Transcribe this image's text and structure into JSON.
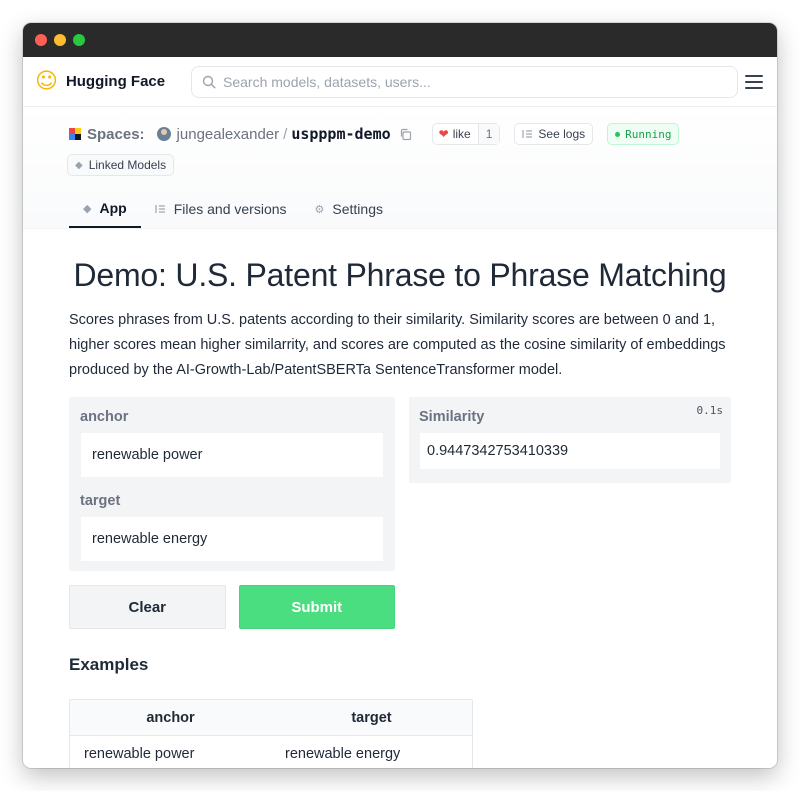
{
  "window": {
    "controls": [
      "close",
      "minimize",
      "zoom"
    ]
  },
  "navbar": {
    "brand": "Hugging Face",
    "logo_icon": "hugging-face-emoji",
    "search_placeholder": "Search models, datasets, users...",
    "menu_icon": "hamburger-menu-icon"
  },
  "space": {
    "section_label": "Spaces:",
    "owner": "jungealexander",
    "separator": "/",
    "repo": "uspppm-demo",
    "like_label": "like",
    "like_count": "1",
    "logs_label": "See logs",
    "status": "Running",
    "linked_models_label": "Linked Models",
    "tabs": [
      {
        "label": "App",
        "active": true
      },
      {
        "label": "Files and versions",
        "active": false
      },
      {
        "label": "Settings",
        "active": false
      }
    ]
  },
  "demo": {
    "title": "Demo: U.S. Patent Phrase to Phrase Matching",
    "description": "Scores phrases from U.S. patents according to their similarity. Similarity scores are between 0 and 1, higher scores mean higher similarrity, and scores are computed as the cosine similarity of embeddings produced by the AI-Growth-Lab/PatentSBERTa SentenceTransformer model."
  },
  "inputs": {
    "anchor_label": "anchor",
    "anchor_value": "renewable power",
    "target_label": "target",
    "target_value": "renewable energy"
  },
  "buttons": {
    "clear": "Clear",
    "submit": "Submit"
  },
  "output": {
    "label": "Similarity",
    "time": "0.1s",
    "value": "0.9447342753410339"
  },
  "examples": {
    "title": "Examples",
    "columns": [
      "anchor",
      "target"
    ],
    "rows": [
      [
        "renewable power",
        "renewable energy"
      ]
    ]
  },
  "colors": {
    "submit_bg": "#4ade80",
    "running": "#16a34a",
    "heart": "#ef4444"
  }
}
